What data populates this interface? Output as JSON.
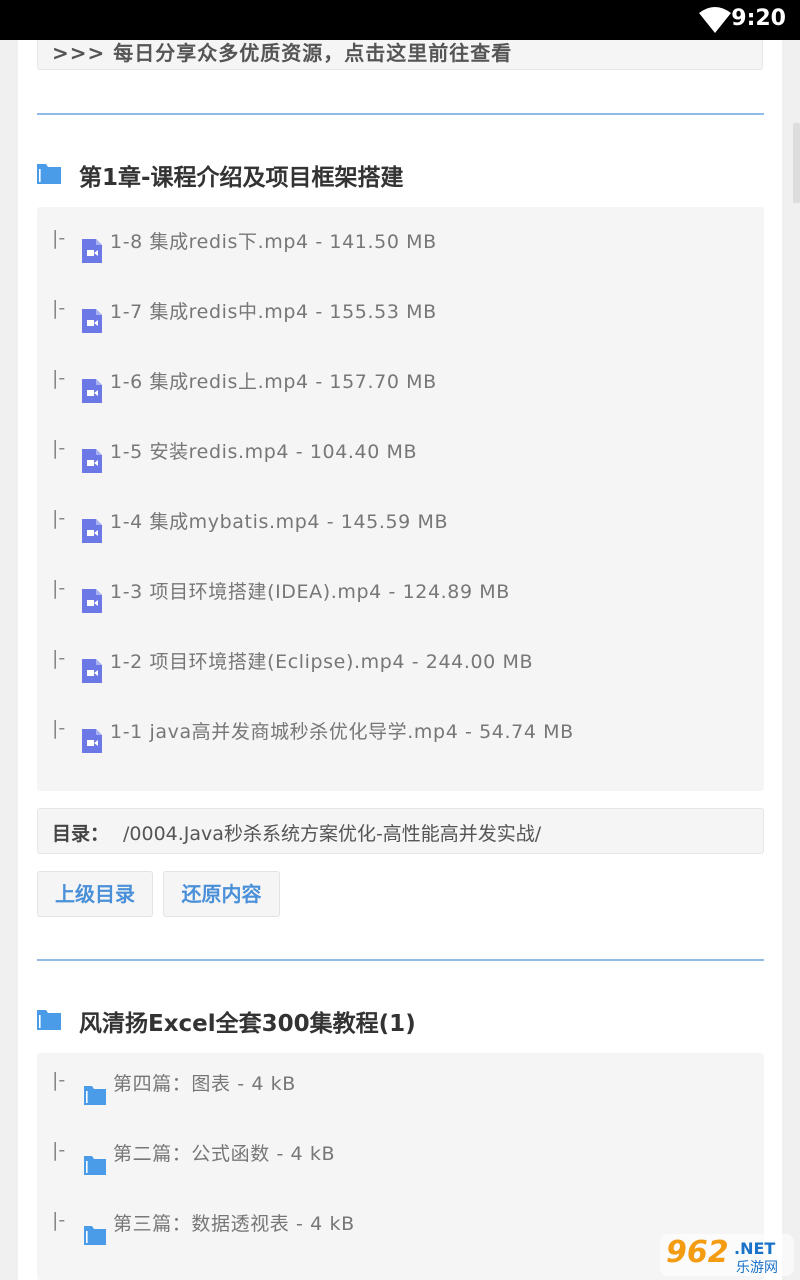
{
  "status_bar": {
    "time": "9:20",
    "wifi_icon": "wifi-icon"
  },
  "notice": ">>> 每日分享众多优质资源，点击这里前往查看",
  "section1": {
    "title": "第1章-课程介绍及项目框架搭建",
    "files": [
      {
        "prefix": "|-",
        "name": "1-8 集成redis下.mp4  - 141.50 MB"
      },
      {
        "prefix": "|-",
        "name": "1-7 集成redis中.mp4  - 155.53 MB"
      },
      {
        "prefix": "|-",
        "name": "1-6 集成redis上.mp4  - 157.70 MB"
      },
      {
        "prefix": "|-",
        "name": "1-5 安装redis.mp4  - 104.40 MB"
      },
      {
        "prefix": "|-",
        "name": "1-4 集成mybatis.mp4  - 145.59 MB"
      },
      {
        "prefix": "|-",
        "name": "1-3 项目环境搭建(IDEA).mp4  - 124.89 MB"
      },
      {
        "prefix": "|-",
        "name": "1-2 项目环境搭建(Eclipse).mp4  - 244.00 MB"
      },
      {
        "prefix": "|-",
        "name": "1-1 java高并发商城秒杀优化导学.mp4  - 54.74 MB"
      }
    ],
    "path_label": "目录：",
    "path_value": "/0004.Java秒杀系统方案优化-高性能高并发实战/",
    "btn_parent": "上级目录",
    "btn_restore": "还原内容"
  },
  "section2": {
    "title": "风清扬Excel全套300集教程(1)",
    "folders": [
      {
        "prefix": "|-",
        "name": "第四篇：图表  - 4 kB"
      },
      {
        "prefix": "|-",
        "name": "第二篇：公式函数  - 4 kB"
      },
      {
        "prefix": "|-",
        "name": "第三篇：数据透视表  - 4 kB"
      }
    ]
  },
  "watermark": {
    "brand": "962",
    "suffix": ".NET",
    "cn": "乐游网"
  },
  "colors": {
    "accent": "#4a90d9",
    "rule": "#8fbbe6",
    "file_icon": "#6b78e6",
    "folder_icon": "#4a9be8"
  }
}
